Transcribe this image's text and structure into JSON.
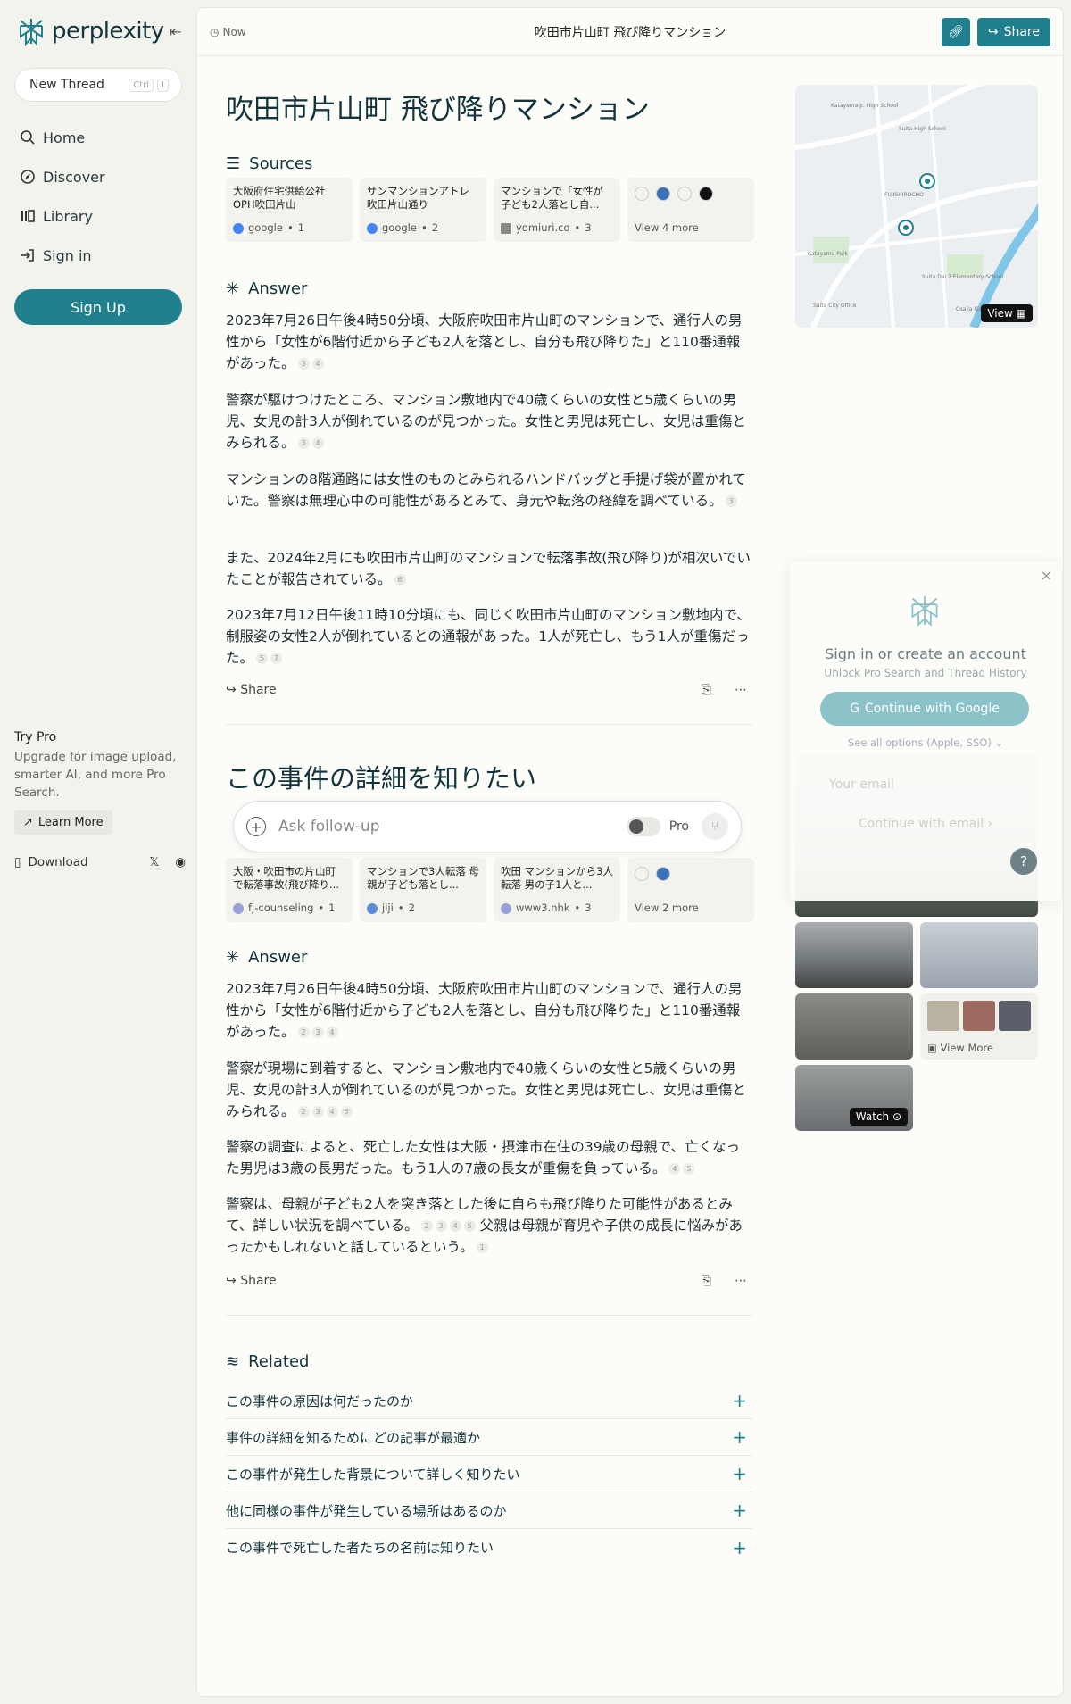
{
  "brand": {
    "name": "perplexity"
  },
  "sidebar": {
    "new_thread": "New Thread",
    "kbd": [
      "Ctrl",
      "I"
    ],
    "nav": [
      {
        "label": "Home",
        "icon": "search-icon"
      },
      {
        "label": "Discover",
        "icon": "compass-icon"
      },
      {
        "label": "Library",
        "icon": "library-icon"
      },
      {
        "label": "Sign in",
        "icon": "signin-icon"
      }
    ],
    "signup": "Sign Up",
    "try_pro": {
      "title": "Try Pro",
      "desc": "Upgrade for image upload, smarter AI, and more Pro Search.",
      "learn_more": "Learn More"
    },
    "download": "Download"
  },
  "topbar": {
    "time": "Now",
    "title": "吹田市片山町 飛び降りマンション",
    "share": "Share"
  },
  "thread1": {
    "title": "吹田市片山町 飛び降りマンション",
    "sources_label": "Sources",
    "sources": [
      {
        "title": "大阪府住宅供給公社OPH吹田片山",
        "site": "google",
        "num": "1"
      },
      {
        "title": "サンマンションアトレ吹田片山通り",
        "site": "google",
        "num": "2"
      },
      {
        "title": "マンションで「女性が子ども2人落とし自...",
        "site": "yomiuri.co",
        "num": "3"
      }
    ],
    "more": "View 4 more",
    "answer_label": "Answer",
    "paragraphs": [
      {
        "text": "2023年7月26日午後4時50分頃、大阪府吹田市片山町のマンションで、通行人の男性から「女性が6階付近から子ども2人を落とし、自分も飛び降りた」と110番通報があった。",
        "cites": [
          "3",
          "4"
        ]
      },
      {
        "text": "警察が駆けつけたところ、マンション敷地内で40歳くらいの女性と5歳くらいの男児、女児の計3人が倒れているのが見つかった。女性と男児は死亡し、女児は重傷とみられる。",
        "cites": [
          "3",
          "4"
        ]
      },
      {
        "text": "マンションの8階通路には女性のものとみられるハンドバッグと手提げ袋が置かれていた。警察は無理心中の可能性があるとみて、身元や転落の経緯を調べている。",
        "cites": [
          "3"
        ]
      },
      {
        "text": "また、2024年2月にも吹田市片山町のマンションで転落事故(飛び降り)が相次いでいたことが報告されている。",
        "cites": [
          "6"
        ]
      },
      {
        "text": "2023年7月12日午後11時10分頃にも、同じく吹田市片山町のマンション敷地内で、制服姿の女性2人が倒れているとの通報があった。1人が死亡し、もう1人が重傷だった。",
        "cites": [
          "5",
          "7"
        ]
      }
    ],
    "share": "Share"
  },
  "thread2": {
    "title": "この事件の詳細を知りたい",
    "sources": [
      {
        "title": "大阪・吹田市の片山町で転落事故(飛び降り...",
        "site": "fj-counseling",
        "num": "1"
      },
      {
        "title": "マンションで3人転落 母親が子ども落とし...",
        "site": "jiji",
        "num": "2"
      },
      {
        "title": "吹田 マンションから3人転落 男の子1人と...",
        "site": "www3.nhk",
        "num": "3"
      }
    ],
    "more": "View 2 more",
    "answer_label": "Answer",
    "paragraphs": [
      {
        "text": "2023年7月26日午後4時50分頃、大阪府吹田市片山町のマンションで、通行人の男性から「女性が6階付近から子ども2人を落とし、自分も飛び降りた」と110番通報があった。",
        "cites": [
          "2",
          "3",
          "4"
        ]
      },
      {
        "text": "警察が現場に到着すると、マンション敷地内で40歳くらいの女性と5歳くらいの男児、女児の計3人が倒れているのが見つかった。女性と男児は死亡し、女児は重傷とみられる。",
        "cites": [
          "2",
          "3",
          "4",
          "5"
        ]
      },
      {
        "text": "警察の調査によると、死亡した女性は大阪・摂津市在住の39歳の母親で、亡くなった男児は3歳の長男だった。もう1人の7歳の長女が重傷を負っている。",
        "cites": [
          "4",
          "5"
        ]
      },
      {
        "text": "警察は、母親が子ども2人を突き落とした後に自らも飛び降りた可能性があるとみて、詳しい状況を調べている。",
        "cites": [
          "2",
          "3",
          "4",
          "5"
        ],
        "tail": "父親は母親が育児や子供の成長に悩みがあったかもしれないと話しているという。",
        "tail_cites": [
          "1"
        ]
      }
    ],
    "share": "Share"
  },
  "followup": {
    "placeholder": "Ask follow-up",
    "pro": "Pro"
  },
  "related": {
    "label": "Related",
    "items": [
      "この事件の原因は何だったのか",
      "事件の詳細を知るためにどの記事が最適か",
      "この事件が発生した背景について詳しく知りたい",
      "他に同様の事件が発生している場所はあるのか",
      "この事件で死亡した者たちの名前は知りたい"
    ]
  },
  "map": {
    "view": "View",
    "labels": [
      "Katayama Jr. High School",
      "Suita High School",
      "FUJISHIROCHO",
      "Katayama Park",
      "Suita Dai 2 Elementary School",
      "Suita City Office",
      "Osaka Gakuin University"
    ]
  },
  "signin": {
    "title": "Sign in or create an account",
    "subtitle": "Unlock Pro Search and Thread History",
    "google": "Continue with Google",
    "see_all": "See all options (Apple, SSO)",
    "email_placeholder": "Your email",
    "continue_email": "Continue with email"
  },
  "images": {
    "view_more": "View More",
    "watch": "Watch"
  },
  "colors": {
    "accent": "#20808d",
    "bg": "#f3f3ee",
    "panel": "#fcfcf9"
  }
}
